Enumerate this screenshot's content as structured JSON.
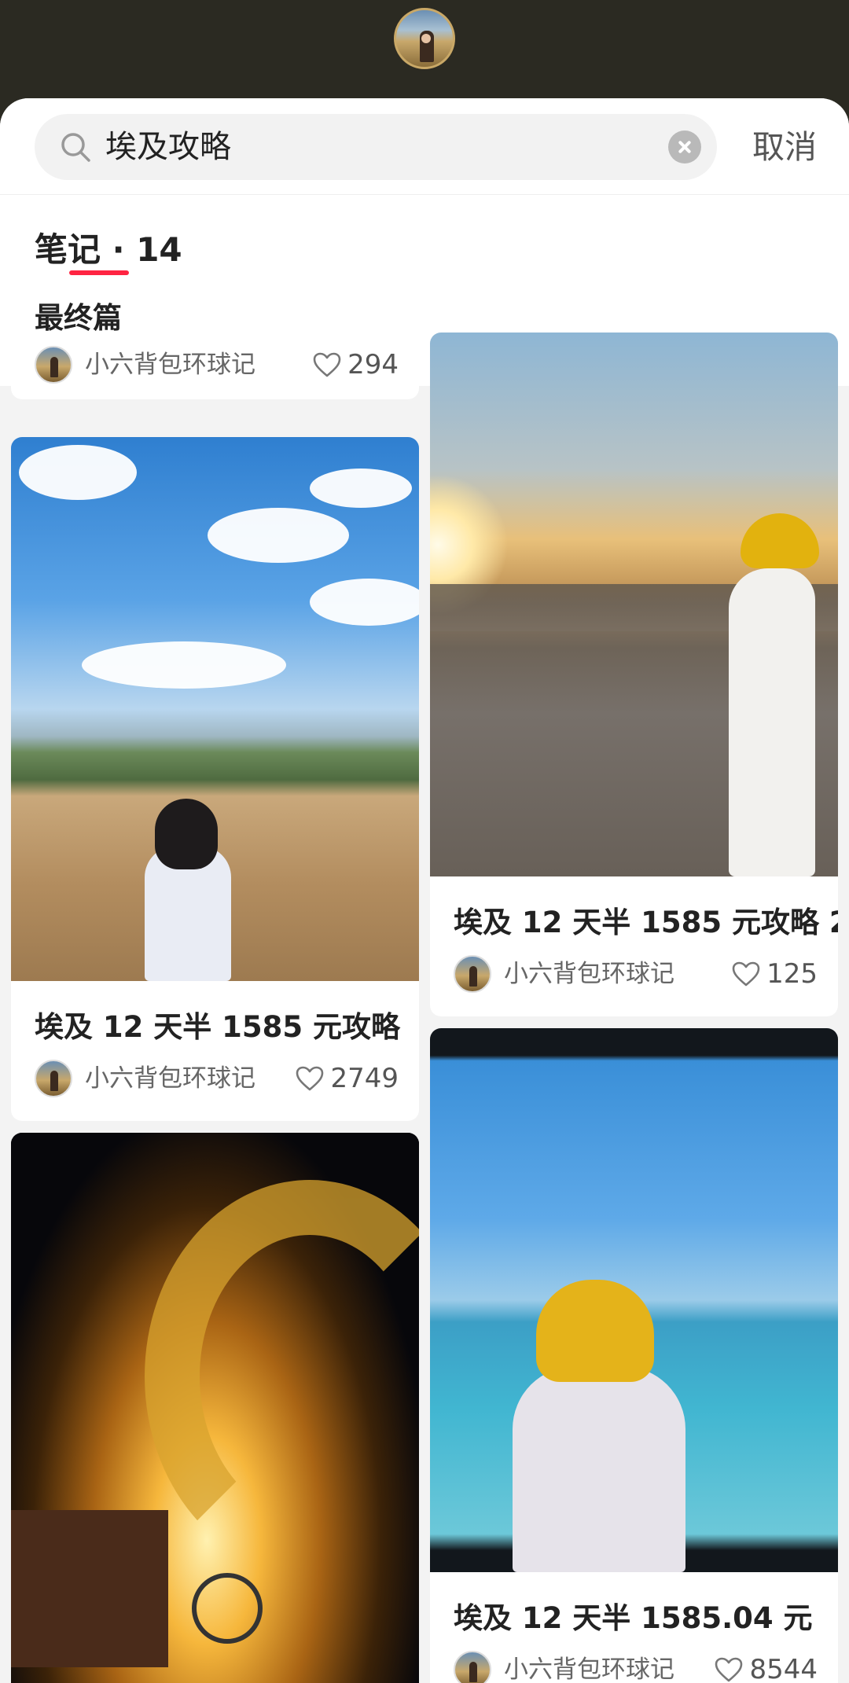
{
  "search": {
    "query": "埃及攻略",
    "cancel_label": "取消"
  },
  "tabs": {
    "notes_label": "笔记 · 14"
  },
  "cards": {
    "c0": {
      "title": "最终篇",
      "author": "小六背包环球记",
      "likes": "294"
    },
    "c1": {
      "title": "埃及 12 天半 1585 元攻略 2",
      "author": "小六背包环球记",
      "likes": "125"
    },
    "c2": {
      "title": "埃及 12 天半 1585 元攻略",
      "author": "小六背包环球记",
      "likes": "2749"
    },
    "c3": {
      "title": "埃及 12 天半 1585.04 元",
      "author": "小六背包环球记",
      "likes": "8544"
    }
  },
  "colors": {
    "accent": "#ff2442",
    "header_bg": "#2b2a22",
    "feed_bg": "#f3f3f3"
  },
  "icons": [
    "search-icon",
    "clear-icon",
    "heart-icon",
    "avatar"
  ]
}
